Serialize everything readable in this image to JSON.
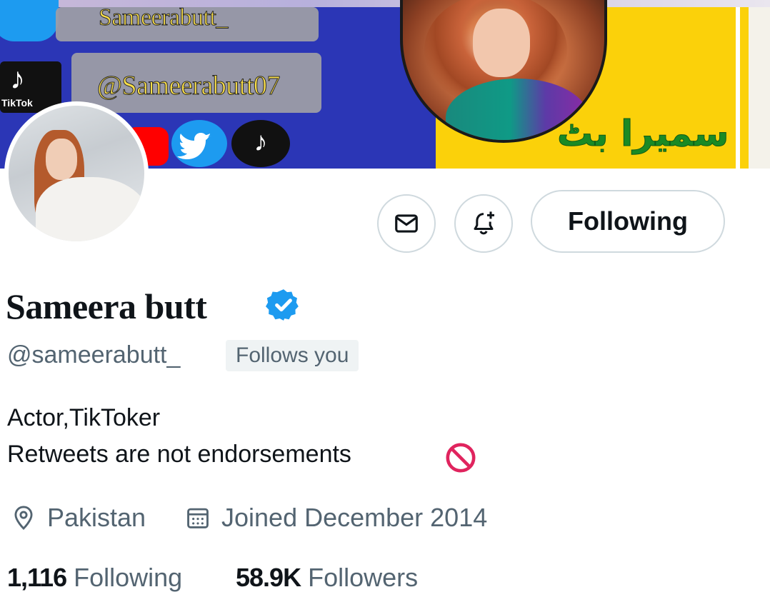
{
  "banner": {
    "handle_top": "Sameerabutt_",
    "handle_tiktok": "@Sameerabutt07",
    "tiktok_label": "TikTok",
    "urdu_name": "سمیرا بٹ",
    "icons": [
      "twitter-icon",
      "tiktok-icon",
      "youtube-icon",
      "twitter-icon",
      "tiktok-icon"
    ]
  },
  "actions": {
    "message_icon": "envelope-icon",
    "notify_icon": "bell-plus-icon",
    "following_label": "Following"
  },
  "profile": {
    "display_name": "Sameera butt",
    "verified": true,
    "handle": "@sameerabutt_",
    "follows_you": "Follows you",
    "bio_line1": "Actor,TikToker",
    "bio_line2": "Retweets are not endorsements",
    "location": "Pakistan",
    "joined": "Joined December 2014"
  },
  "stats": {
    "following_count": "1,116",
    "following_label": "Following",
    "followers_count": "58.9K",
    "followers_label": "Followers"
  },
  "colors": {
    "text_primary": "#0f1419",
    "text_secondary": "#536471",
    "verified_blue": "#1d9bf0",
    "border": "#cfd9de",
    "banner_blue": "#2b36b6",
    "banner_yellow": "#fbd10a",
    "no_entry_red": "#e0245e"
  }
}
